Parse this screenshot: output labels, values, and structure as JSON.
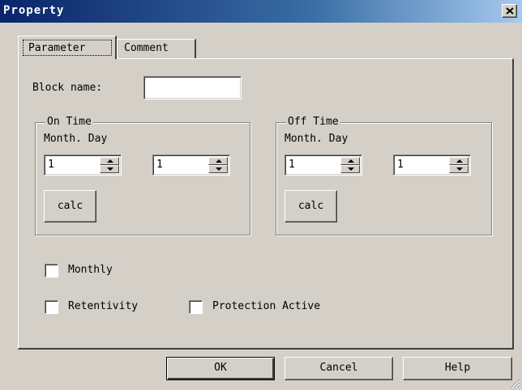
{
  "window": {
    "title": "Property",
    "close_icon": "close-icon"
  },
  "tabs": [
    {
      "label": "Parameter",
      "active": true
    },
    {
      "label": "Comment",
      "active": false
    }
  ],
  "block_name": {
    "label": "Block name:",
    "value": ""
  },
  "on_time": {
    "title": "On Time",
    "header": "Month. Day",
    "month_value": "1",
    "day_value": "1",
    "calc_label": "calc"
  },
  "off_time": {
    "title": "Off Time",
    "header": "Month. Day",
    "month_value": "1",
    "day_value": "1",
    "calc_label": "calc"
  },
  "checkboxes": {
    "monthly": {
      "label": "Monthly",
      "checked": false
    },
    "retentivity": {
      "label": "Retentivity",
      "checked": false
    },
    "protection_active": {
      "label": "Protection Active",
      "checked": false
    }
  },
  "buttons": {
    "ok": "OK",
    "cancel": "Cancel",
    "help": "Help"
  },
  "colors": {
    "title_bar": "#0a246a",
    "face": "#d4d0c8"
  }
}
